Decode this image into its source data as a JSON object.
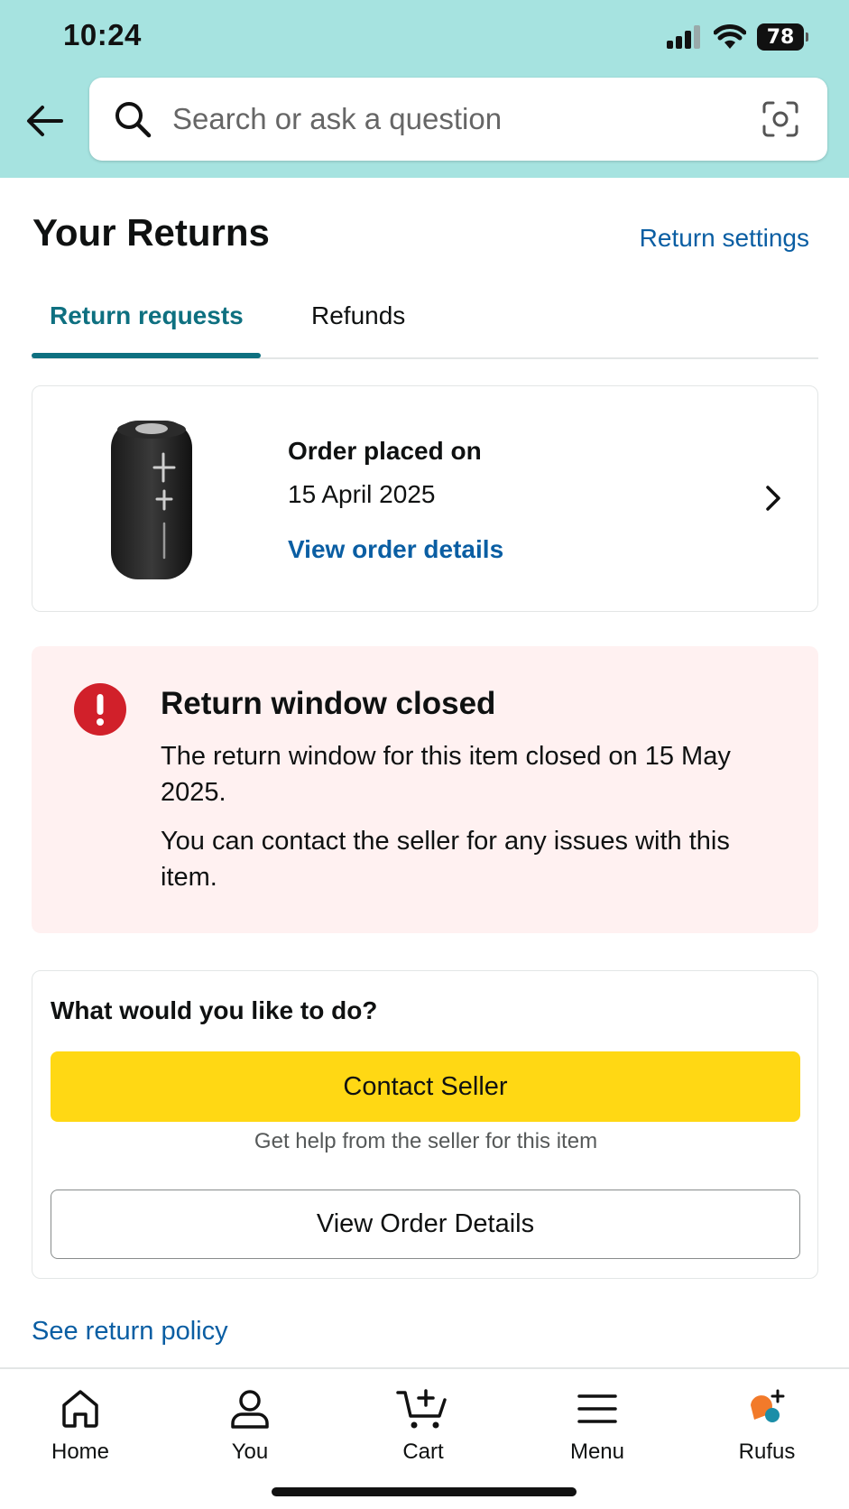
{
  "status_bar": {
    "time": "10:24",
    "battery": "78"
  },
  "search": {
    "placeholder": "Search or ask a question"
  },
  "page": {
    "title": "Your Returns",
    "settings_link": "Return settings"
  },
  "tabs": [
    {
      "label": "Return requests",
      "active": true
    },
    {
      "label": "Refunds",
      "active": false
    }
  ],
  "order": {
    "placed_label": "Order placed on",
    "date": "15 April 2025",
    "details_link": "View order details"
  },
  "alert": {
    "title": "Return window closed",
    "message": "The return window for this item closed on 15 May 2025.",
    "message2": "You can contact the seller for any issues with this item."
  },
  "actions": {
    "title": "What would you like to do?",
    "contact_button": "Contact Seller",
    "contact_sub": "Get help from the seller for this item",
    "view_order_button": "View Order Details"
  },
  "return_policy_link": "See return policy",
  "bottom_nav": [
    {
      "label": "Home",
      "icon": "home-icon"
    },
    {
      "label": "You",
      "icon": "person-icon"
    },
    {
      "label": "Cart",
      "icon": "cart-icon"
    },
    {
      "label": "Menu",
      "icon": "menu-icon"
    },
    {
      "label": "Rufus",
      "icon": "rufus-icon"
    }
  ],
  "colors": {
    "header_bg": "#a6e3e0",
    "accent_teal": "#0e7080",
    "link_blue": "#0a5ea3",
    "primary_button": "#ffd814",
    "alert_bg": "#fff1f1",
    "alert_icon": "#d1202a"
  }
}
